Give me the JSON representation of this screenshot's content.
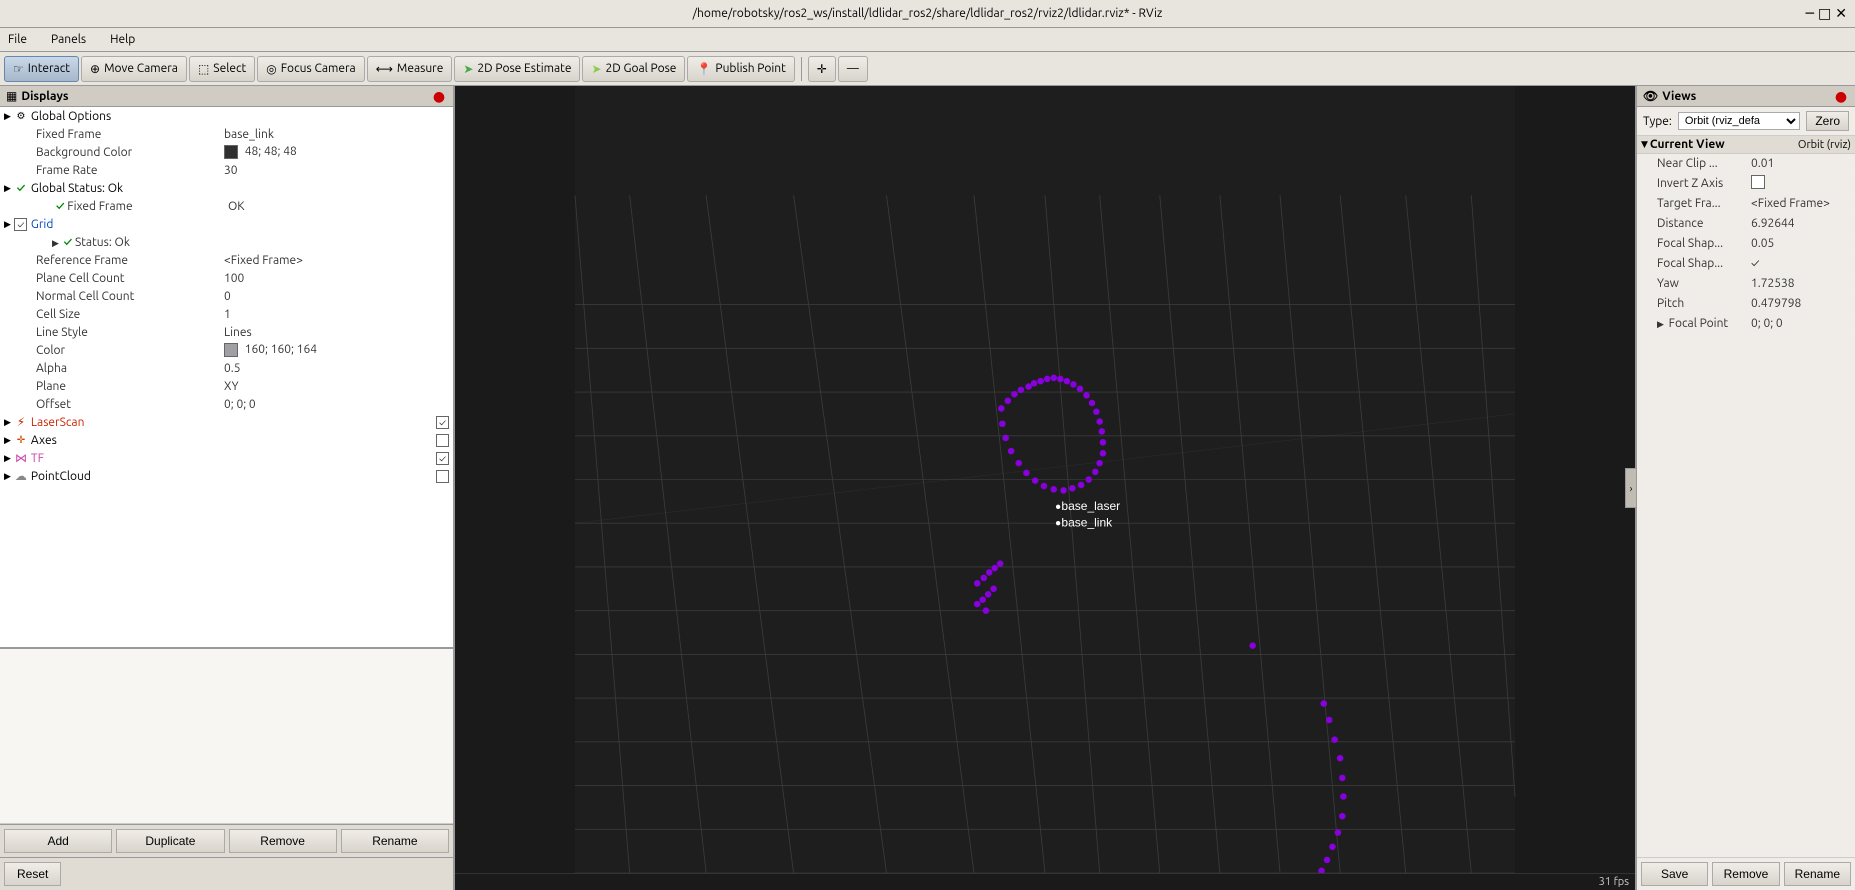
{
  "titlebar": {
    "title": "/home/robotsky/ros2_ws/install/ldlidar_ros2/share/ldlidar_ros2/rviz2/ldlidar.rviz* - RViz"
  },
  "menubar": {
    "items": [
      "File",
      "Panels",
      "Help"
    ]
  },
  "toolbar": {
    "interact_label": "Interact",
    "move_camera_label": "Move Camera",
    "select_label": "Select",
    "focus_camera_label": "Focus Camera",
    "measure_label": "Measure",
    "pose_estimate_label": "2D Pose Estimate",
    "goal_pose_label": "2D Goal Pose",
    "publish_point_label": "Publish Point"
  },
  "displays": {
    "panel_title": "Displays",
    "global_options_label": "Global Options",
    "fixed_frame_label": "Fixed Frame",
    "fixed_frame_value": "base_link",
    "background_color_label": "Background Color",
    "background_color_value": "48; 48; 48",
    "frame_rate_label": "Frame Rate",
    "frame_rate_value": "30",
    "global_status_label": "Global Status: Ok",
    "fixed_frame_status_label": "Fixed Frame",
    "fixed_frame_status_value": "OK",
    "grid_label": "Grid",
    "grid_status_label": "Status: Ok",
    "reference_frame_label": "Reference Frame",
    "reference_frame_value": "<Fixed Frame>",
    "plane_cell_count_label": "Plane Cell Count",
    "plane_cell_count_value": "100",
    "normal_cell_count_label": "Normal Cell Count",
    "normal_cell_count_value": "0",
    "cell_size_label": "Cell Size",
    "cell_size_value": "1",
    "line_style_label": "Line Style",
    "line_style_value": "Lines",
    "color_label": "Color",
    "color_value": "160; 160; 164",
    "alpha_label": "Alpha",
    "alpha_value": "0.5",
    "plane_label": "Plane",
    "plane_value": "XY",
    "offset_label": "Offset",
    "offset_value": "0; 0; 0",
    "laser_scan_label": "LaserScan",
    "axes_label": "Axes",
    "tf_label": "TF",
    "point_cloud_label": "PointCloud",
    "add_btn": "Add",
    "duplicate_btn": "Duplicate",
    "remove_btn": "Remove",
    "rename_btn": "Rename",
    "reset_btn": "Reset"
  },
  "views": {
    "panel_title": "Views",
    "type_label": "Type:",
    "type_value": "Orbit (rviz_defa",
    "zero_btn": "Zero",
    "current_view_label": "Current View",
    "current_view_type": "Orbit (rviz)",
    "near_clip_label": "Near Clip ...",
    "near_clip_value": "0.01",
    "invert_z_label": "Invert Z Axis",
    "target_fra_label": "Target Fra...",
    "target_fra_value": "<Fixed Frame>",
    "distance_label": "Distance",
    "distance_value": "6.92644",
    "focal_shap1_label": "Focal Shap...",
    "focal_shap1_value": "0.05",
    "focal_shap2_label": "Focal Shap...",
    "focal_shap2_value": "✓",
    "yaw_label": "Yaw",
    "yaw_value": "1.72538",
    "pitch_label": "Pitch",
    "pitch_value": "0.479798",
    "focal_point_label": "Focal Point",
    "focal_point_value": "0; 0; 0",
    "save_btn": "Save",
    "remove_btn": "Remove",
    "rename_btn": "Rename"
  },
  "fps": {
    "value": "31 fps"
  },
  "viewport": {
    "base_laser_label": "base_laser",
    "base_link_label": "base_link"
  }
}
